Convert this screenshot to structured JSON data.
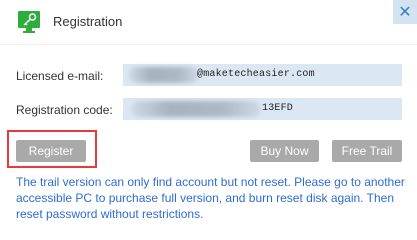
{
  "window": {
    "title": "Registration",
    "close_glyph": "✕",
    "app_icon": "key-monitor-icon",
    "accent_color": "#2fae3e",
    "link_color": "#2d6dd3"
  },
  "form": {
    "email_label": "Licensed e-mail:",
    "email_visible_value": "@maketecheasier.com",
    "code_label": "Registration code:",
    "code_visible_value": "13EFD"
  },
  "buttons": {
    "register": "Register",
    "buy_now": "Buy Now",
    "free_trial": "Free Trail"
  },
  "notice": "The trail version can only find account but not reset. Please go to another accessible PC to purchase full version, and burn reset disk again. Then reset password without restrictions."
}
